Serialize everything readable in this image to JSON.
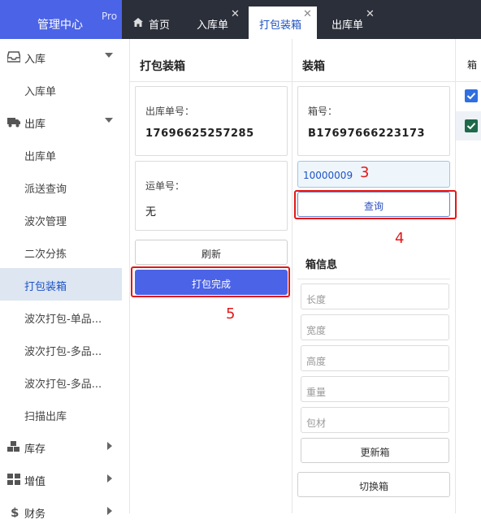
{
  "app": {
    "title": "管理中心",
    "badge": "Pro"
  },
  "tabs": [
    {
      "label": "首页",
      "closable": false,
      "active": false
    },
    {
      "label": "入库单",
      "closable": true,
      "active": false
    },
    {
      "label": "打包装箱",
      "closable": true,
      "active": true
    },
    {
      "label": "出库单",
      "closable": true,
      "active": false
    }
  ],
  "close_glyph": "✕",
  "sidebar": {
    "items": [
      {
        "label": "入库",
        "type": "parent",
        "icon": "inbox-icon",
        "arrow": "down"
      },
      {
        "label": "入库单",
        "type": "child"
      },
      {
        "label": "出库",
        "type": "parent",
        "icon": "truck-icon",
        "arrow": "down"
      },
      {
        "label": "出库单",
        "type": "child"
      },
      {
        "label": "派送查询",
        "type": "child"
      },
      {
        "label": "波次管理",
        "type": "child"
      },
      {
        "label": "二次分拣",
        "type": "child"
      },
      {
        "label": "打包装箱",
        "type": "child",
        "active": true
      },
      {
        "label": "波次打包-单品...",
        "type": "child"
      },
      {
        "label": "波次打包-多品...",
        "type": "child"
      },
      {
        "label": "波次打包-多品...",
        "type": "child"
      },
      {
        "label": "扫描出库",
        "type": "child"
      },
      {
        "label": "库存",
        "type": "parent",
        "icon": "cubes-icon",
        "arrow": "right"
      },
      {
        "label": "增值",
        "type": "parent",
        "icon": "grid-icon",
        "arrow": "right"
      },
      {
        "label": "财务",
        "type": "parent",
        "icon": "dollar-icon",
        "arrow": "right"
      }
    ]
  },
  "pack_panel": {
    "title": "打包装箱",
    "order_label": "出库单号：",
    "order_value": "17696625257285",
    "waybill_label": "运单号：",
    "waybill_value": "无",
    "refresh_button": "刷新",
    "complete_button": "打包完成"
  },
  "box_panel": {
    "title": "装箱",
    "box_no_label": "箱号：",
    "box_no_value": "B17697666223173",
    "box_input_value": "10000009",
    "query_button": "查询",
    "box_info_title": "箱信息",
    "length_placeholder": "长度",
    "width_placeholder": "宽度",
    "height_placeholder": "高度",
    "weight_placeholder": "重量",
    "material_placeholder": "包材",
    "update_button": "更新箱",
    "switch_button": "切换箱"
  },
  "right_panel": {
    "title": "箱"
  },
  "annotations": {
    "n3": "3",
    "n4": "4",
    "n5": "5"
  },
  "colors": {
    "brand": "#4b63e6",
    "topbar": "#2b2f3a",
    "annotation": "#e31818",
    "active_bg": "#dde6f1"
  }
}
